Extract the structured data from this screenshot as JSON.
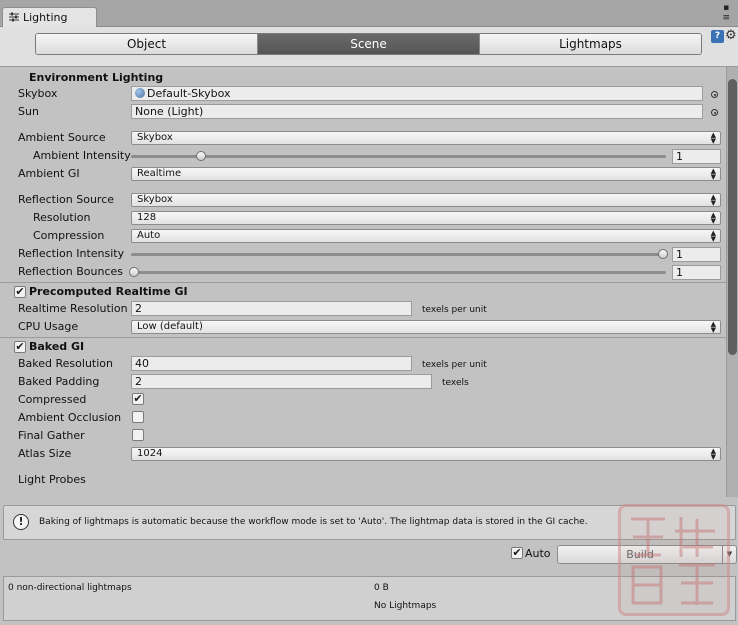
{
  "window": {
    "tab_title": "Lighting",
    "window_buttons": "▪\n≡"
  },
  "toolbar": {
    "tabs": [
      "Object",
      "Scene",
      "Lightmaps"
    ],
    "active_tab": "Scene",
    "help_glyph": "?",
    "gear_glyph": "⚙"
  },
  "environment": {
    "header": "Environment Lighting",
    "skybox_label": "Skybox",
    "skybox_value": "Default-Skybox",
    "sun_label": "Sun",
    "sun_value": "None (Light)",
    "ambient_source_label": "Ambient Source",
    "ambient_source_value": "Skybox",
    "ambient_intensity_label": "Ambient Intensity",
    "ambient_intensity_value": "1",
    "ambient_gi_label": "Ambient GI",
    "ambient_gi_value": "Realtime",
    "reflection_source_label": "Reflection Source",
    "reflection_source_value": "Skybox",
    "resolution_label": "Resolution",
    "resolution_value": "128",
    "compression_label": "Compression",
    "compression_value": "Auto",
    "reflection_intensity_label": "Reflection Intensity",
    "reflection_intensity_value": "1",
    "reflection_bounces_label": "Reflection Bounces",
    "reflection_bounces_value": "1"
  },
  "precomputed": {
    "header": "Precomputed Realtime GI",
    "enabled": true,
    "realtime_resolution_label": "Realtime Resolution",
    "realtime_resolution_value": "2",
    "realtime_resolution_unit": "texels per unit",
    "cpu_usage_label": "CPU Usage",
    "cpu_usage_value": "Low (default)"
  },
  "baked": {
    "header": "Baked GI",
    "enabled": true,
    "baked_resolution_label": "Baked Resolution",
    "baked_resolution_value": "40",
    "baked_resolution_unit": "texels per unit",
    "baked_padding_label": "Baked Padding",
    "baked_padding_value": "2",
    "baked_padding_unit": "texels",
    "compressed_label": "Compressed",
    "compressed": true,
    "ambient_occlusion_label": "Ambient Occlusion",
    "ambient_occlusion": false,
    "final_gather_label": "Final Gather",
    "final_gather": false,
    "atlas_size_label": "Atlas Size",
    "atlas_size_value": "1024",
    "light_probes_label": "Light Probes"
  },
  "info": {
    "icon_glyph": "!",
    "message": "Baking of lightmaps is automatic because the workflow mode is set to 'Auto'. The lightmap data is stored in the GI cache."
  },
  "build": {
    "auto_label": "Auto",
    "auto_checked": true,
    "build_label": "Build"
  },
  "stats": {
    "lightmaps_count": "0 non-directional lightmaps",
    "size": "0 B",
    "status": "No Lightmaps"
  },
  "colors": {
    "panel_bg": "#c2c2c2",
    "active_tab_bg": "#5f5f5f",
    "scroll_thumb": "#5f5f5f"
  }
}
